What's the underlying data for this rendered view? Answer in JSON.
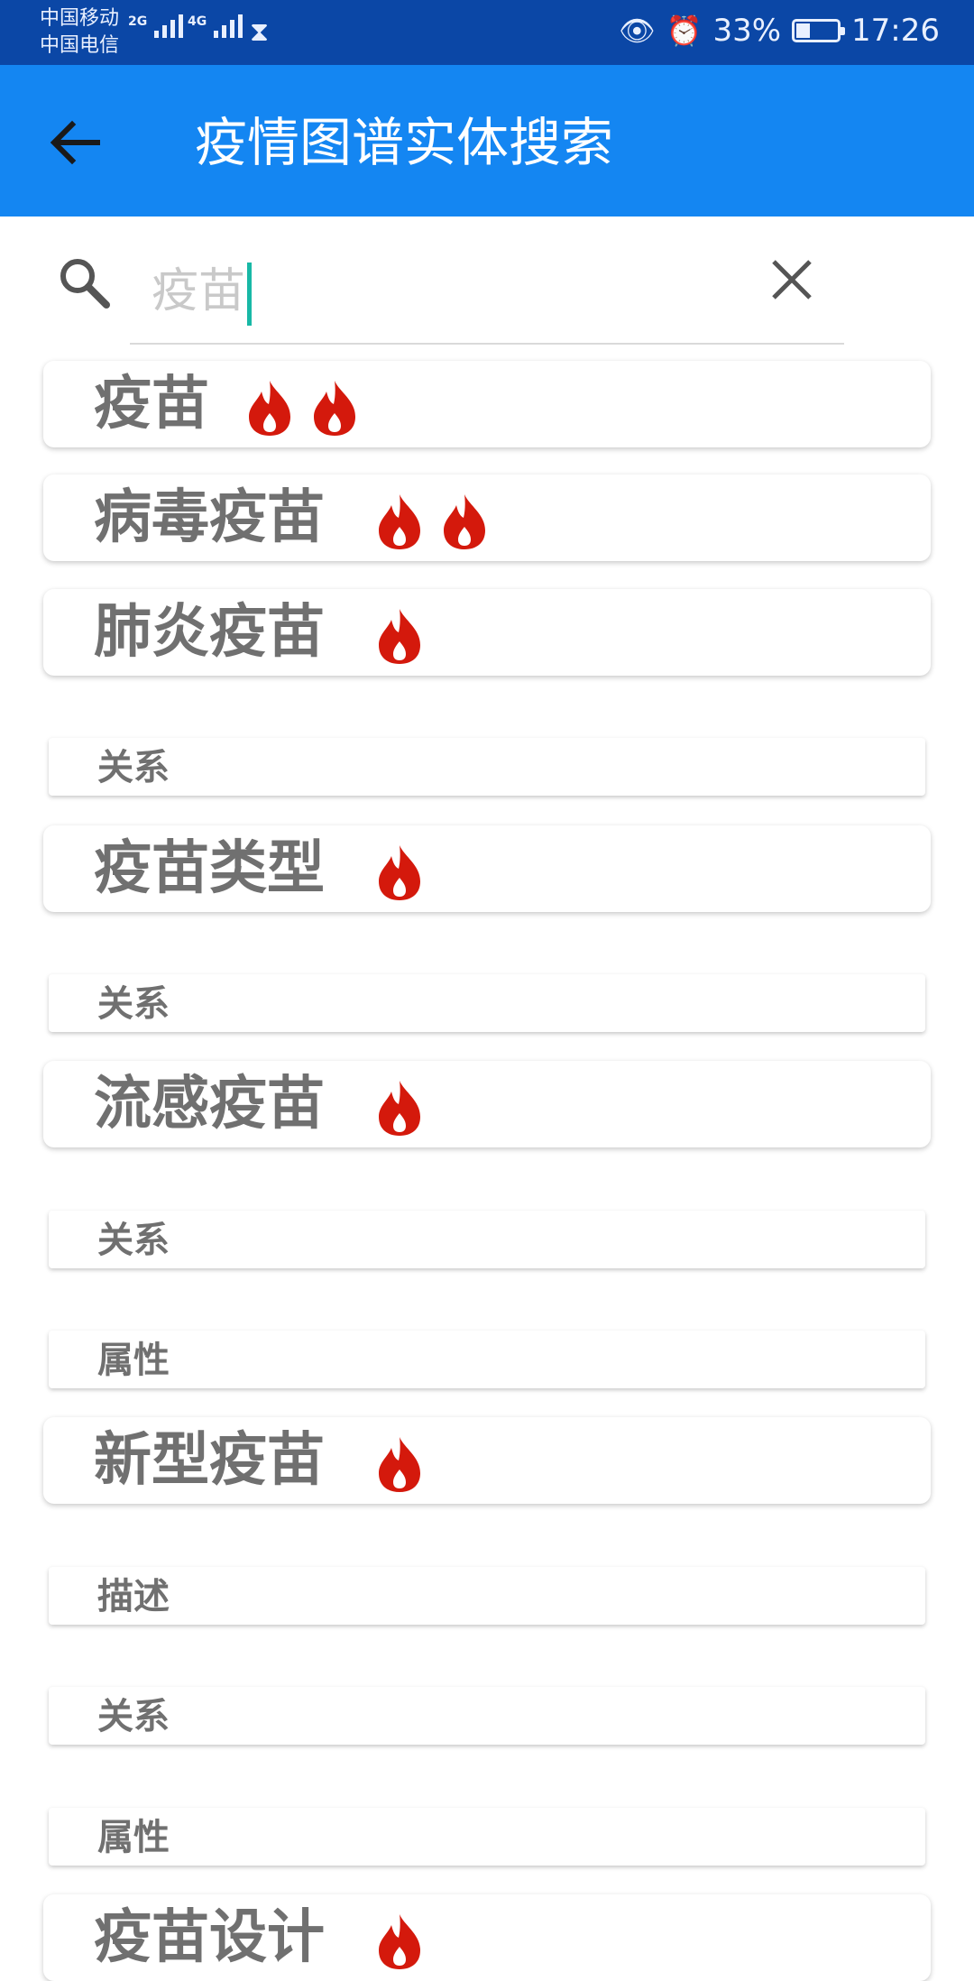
{
  "status_bar": {
    "carrier1": "中国移动",
    "carrier2": "中国电信",
    "net1": "2G",
    "net2": "4G",
    "battery_text": "33%",
    "battery_level": 0.33,
    "time": "17:26"
  },
  "app_bar": {
    "title": "疫情图谱实体搜索"
  },
  "search": {
    "value": "疫苗",
    "icon": "search-icon",
    "clear_icon": "close-icon"
  },
  "results": [
    {
      "type": "entity",
      "label": "疫苗",
      "flames": 2
    },
    {
      "type": "entity",
      "label": "病毒疫苗",
      "flames": 2
    },
    {
      "type": "entity",
      "label": "肺炎疫苗",
      "flames": 1
    },
    {
      "type": "section",
      "label": "关系"
    },
    {
      "type": "entity",
      "label": "疫苗类型",
      "flames": 1
    },
    {
      "type": "section",
      "label": "关系"
    },
    {
      "type": "entity",
      "label": "流感疫苗",
      "flames": 1
    },
    {
      "type": "section",
      "label": "关系"
    },
    {
      "type": "section",
      "label": "属性"
    },
    {
      "type": "entity",
      "label": "新型疫苗",
      "flames": 1
    },
    {
      "type": "section",
      "label": "描述"
    },
    {
      "type": "section",
      "label": "关系"
    },
    {
      "type": "section",
      "label": "属性"
    },
    {
      "type": "entity",
      "label": "疫苗设计",
      "flames": 1
    }
  ],
  "colors": {
    "status_bar": "#0b47a6",
    "app_bar": "#1486f2",
    "flame": "#d4190c",
    "caret": "#18b8a6",
    "label": "#707070"
  }
}
